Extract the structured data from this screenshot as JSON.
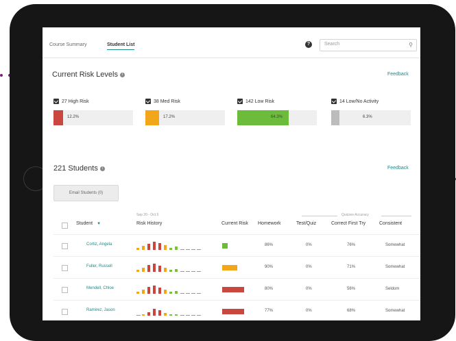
{
  "nav": {
    "tabs": [
      "Course Summary",
      "Student List"
    ],
    "active_tab": 1,
    "help_label": "?",
    "search_placeholder": "Search"
  },
  "risk": {
    "title": "Current Risk Levels",
    "feedback": "Feedback",
    "items": [
      {
        "label": "27 High Risk",
        "pct_text": "12.2%",
        "fraction": 0.122,
        "color": "#c9473f"
      },
      {
        "label": "38 Med Risk",
        "pct_text": "17.2%",
        "fraction": 0.172,
        "color": "#f2a71b"
      },
      {
        "label": "142 Low Risk",
        "pct_text": "64.3%",
        "fraction": 0.643,
        "color": "#6dbb3a"
      },
      {
        "label": "14 Low/No Activity",
        "pct_text": "6.3%",
        "fraction": 0.063,
        "color": "#bcbcbc"
      }
    ]
  },
  "students": {
    "title": "221 Students",
    "feedback": "Feedback",
    "email_button": "Email Students (0)",
    "group_label": "Quizzes Accuracy",
    "date_label": "Sep 20 - Oct 5",
    "columns": [
      "Student",
      "Risk History",
      "Current Risk",
      "Homework",
      "Test/Quiz",
      "Correct First Try",
      "Consistent"
    ],
    "sort_indicator": "▼",
    "rows": [
      {
        "name": "Cortiz, Angela",
        "current_color": "#6dbb3a",
        "current_fraction": 0.25,
        "homework": "86%",
        "test": "0%",
        "cft": "76%",
        "consistent": "Somewhat",
        "history": [
          [
            3,
            "o"
          ],
          [
            6,
            "o"
          ],
          [
            9,
            "r"
          ],
          [
            12,
            "r"
          ],
          [
            10,
            "r"
          ],
          [
            7,
            "o"
          ],
          [
            3,
            "g"
          ],
          [
            5,
            "g"
          ],
          [
            1,
            "d"
          ],
          [
            1,
            "d"
          ],
          [
            1,
            "d"
          ],
          [
            1,
            "d"
          ]
        ]
      },
      {
        "name": "Fuller, Russell",
        "current_color": "#f2a71b",
        "current_fraction": 0.7,
        "homework": "90%",
        "test": "0%",
        "cft": "71%",
        "consistent": "Somewhat",
        "history": [
          [
            3,
            "o"
          ],
          [
            6,
            "o"
          ],
          [
            10,
            "r"
          ],
          [
            12,
            "r"
          ],
          [
            9,
            "r"
          ],
          [
            6,
            "o"
          ],
          [
            3,
            "g"
          ],
          [
            4,
            "g"
          ],
          [
            1,
            "d"
          ],
          [
            1,
            "d"
          ],
          [
            1,
            "d"
          ],
          [
            1,
            "d"
          ]
        ]
      },
      {
        "name": "Mendell, Chloe",
        "current_color": "#c9473f",
        "current_fraction": 1.0,
        "homework": "80%",
        "test": "0%",
        "cft": "56%",
        "consistent": "Seldom",
        "history": [
          [
            3,
            "o"
          ],
          [
            6,
            "o"
          ],
          [
            10,
            "r"
          ],
          [
            12,
            "r"
          ],
          [
            9,
            "r"
          ],
          [
            6,
            "o"
          ],
          [
            3,
            "g"
          ],
          [
            4,
            "g"
          ],
          [
            1,
            "d"
          ],
          [
            1,
            "d"
          ],
          [
            1,
            "d"
          ],
          [
            1,
            "d"
          ]
        ]
      },
      {
        "name": "Ramirez, Jason",
        "current_color": "#c9473f",
        "current_fraction": 1.0,
        "homework": "77%",
        "test": "0%",
        "cft": "68%",
        "consistent": "Somewhat",
        "history": [
          [
            1,
            "d"
          ],
          [
            2,
            "o"
          ],
          [
            5,
            "r"
          ],
          [
            10,
            "r"
          ],
          [
            8,
            "r"
          ],
          [
            4,
            "o"
          ],
          [
            2,
            "g"
          ],
          [
            2,
            "g"
          ],
          [
            1,
            "d"
          ],
          [
            1,
            "d"
          ],
          [
            1,
            "d"
          ],
          [
            1,
            "d"
          ]
        ]
      }
    ]
  }
}
